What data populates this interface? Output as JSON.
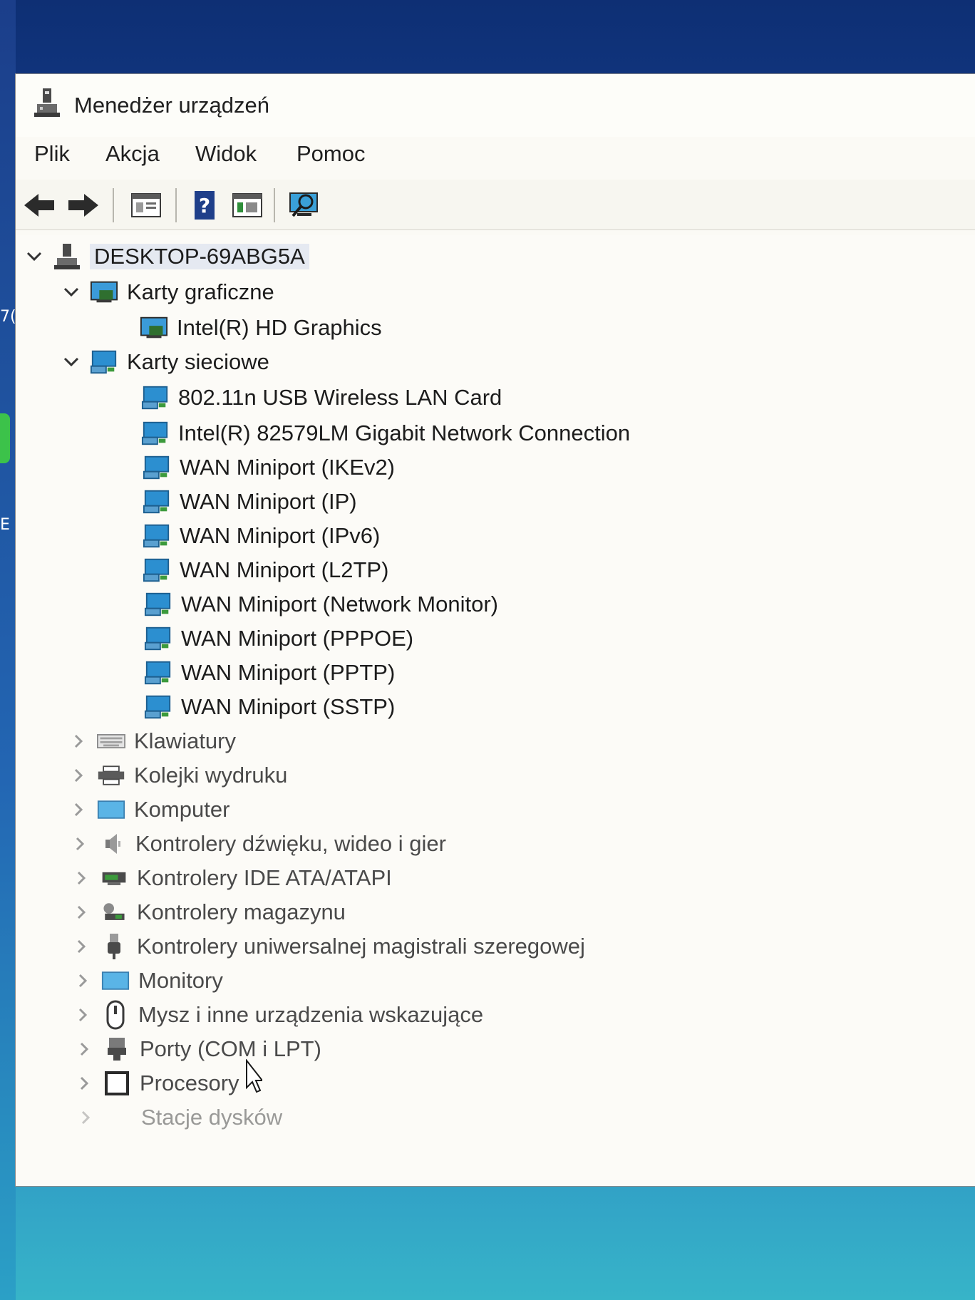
{
  "window": {
    "title": "Menedżer urządzeń"
  },
  "menu": {
    "items": [
      "Plik",
      "Akcja",
      "Widok",
      "Pomoc"
    ]
  },
  "toolbar": {
    "buttons": [
      "back-arrow-icon",
      "forward-arrow-icon",
      "properties-icon",
      "help-icon",
      "update-driver-icon",
      "scan-hardware-icon"
    ]
  },
  "desktop": {
    "fragment_top": "7(",
    "fragment_mid": "E"
  },
  "tree": {
    "root": {
      "label": "DESKTOP-69ABG5A",
      "expanded": true
    },
    "categories": [
      {
        "label": "Karty graficzne",
        "expanded": true,
        "icon": "display-adapter-icon",
        "children": [
          "Intel(R) HD Graphics"
        ]
      },
      {
        "label": "Karty sieciowe",
        "expanded": true,
        "icon": "network-adapter-icon",
        "children": [
          "802.11n USB Wireless LAN Card",
          "Intel(R) 82579LM Gigabit Network Connection",
          "WAN Miniport (IKEv2)",
          "WAN Miniport (IP)",
          "WAN Miniport (IPv6)",
          "WAN Miniport (L2TP)",
          "WAN Miniport (Network Monitor)",
          "WAN Miniport (PPPOE)",
          "WAN Miniport (PPTP)",
          "WAN Miniport (SSTP)"
        ]
      },
      {
        "label": "Klawiatury",
        "expanded": false,
        "icon": "keyboard-icon"
      },
      {
        "label": "Kolejki wydruku",
        "expanded": false,
        "icon": "print-queue-icon"
      },
      {
        "label": "Komputer",
        "expanded": false,
        "icon": "computer-icon"
      },
      {
        "label": "Kontrolery dźwięku, wideo i gier",
        "expanded": false,
        "icon": "sound-icon"
      },
      {
        "label": "Kontrolery IDE ATA/ATAPI",
        "expanded": false,
        "icon": "ide-controller-icon"
      },
      {
        "label": "Kontrolery magazynu",
        "expanded": false,
        "icon": "storage-controller-icon"
      },
      {
        "label": "Kontrolery uniwersalnej magistrali szeregowej",
        "expanded": false,
        "icon": "usb-icon"
      },
      {
        "label": "Monitory",
        "expanded": false,
        "icon": "monitor-icon"
      },
      {
        "label": "Mysz i inne urządzenia wskazujące",
        "expanded": false,
        "icon": "mouse-icon"
      },
      {
        "label": "Porty (COM i LPT)",
        "expanded": false,
        "icon": "port-icon"
      },
      {
        "label": "Procesory",
        "expanded": false,
        "icon": "processor-icon"
      },
      {
        "label": "Stacje dysków",
        "expanded": false,
        "icon": "disk-drive-icon"
      }
    ]
  },
  "colors": {
    "window_bg": "#fbfaf5",
    "selection": "#e5e9f1",
    "network_icon": "#2c8fd0",
    "desktop_bg": "#1a4fa8"
  }
}
